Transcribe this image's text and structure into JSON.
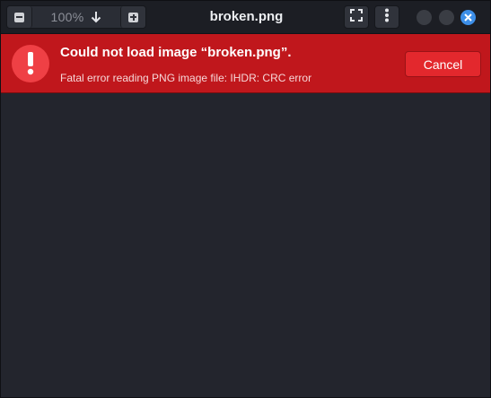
{
  "window": {
    "title": "broken.png"
  },
  "headerbar": {
    "zoom_level": "100%",
    "icons": {
      "zoom_out": "minus-square-icon",
      "zoom_menu": "arrow-down-icon",
      "zoom_in": "plus-square-icon",
      "fullscreen": "fullscreen-icon",
      "menu": "vertical-dots-icon",
      "close": "close-icon"
    }
  },
  "error": {
    "title": "Could not load image “broken.png”.",
    "detail": "Fatal error reading PNG image file: IHDR: CRC error",
    "cancel_label": "Cancel",
    "icon": "exclamation-icon"
  },
  "colors": {
    "banner": "#c0171c",
    "cancel_button": "#e3282d",
    "close_button": "#3d8fe8",
    "canvas": "#23252d"
  }
}
